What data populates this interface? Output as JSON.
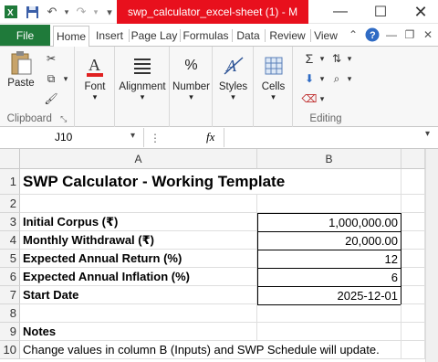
{
  "titlebar": {
    "title": "swp_calculator_excel-sheet (1)  -  M",
    "accent": "#e8101d"
  },
  "tabs": {
    "file": "File",
    "items": [
      "Home",
      "Insert",
      "Page Lay",
      "Formulas",
      "Data",
      "Review",
      "View"
    ],
    "active": "Home",
    "file_color": "#1f7a3a"
  },
  "ribbon": {
    "paste": "Paste",
    "clipboard": "Clipboard",
    "font": "Font",
    "alignment": "Alignment",
    "number": "Number",
    "styles": "Styles",
    "cells": "Cells",
    "editing": "Editing"
  },
  "formula_bar": {
    "name_box": "J10",
    "fx": "fx",
    "value": ""
  },
  "sheet": {
    "columns": [
      "A",
      "B"
    ],
    "rows": [
      "1",
      "2",
      "3",
      "4",
      "5",
      "6",
      "7",
      "8",
      "9",
      "10"
    ],
    "title": "SWP Calculator - Working Template",
    "inputs": [
      {
        "label": "Initial Corpus (₹)",
        "value": "1,000,000.00"
      },
      {
        "label": "Monthly Withdrawal (₹)",
        "value": "20,000.00"
      },
      {
        "label": "Expected Annual Return (%)",
        "value": "12"
      },
      {
        "label": "Expected Annual Inflation (%)",
        "value": "6"
      },
      {
        "label": "Start Date",
        "value": "2025-12-01"
      }
    ],
    "notes_heading": "Notes",
    "note": "Change values in column B (Inputs) and SWP Schedule will update."
  }
}
